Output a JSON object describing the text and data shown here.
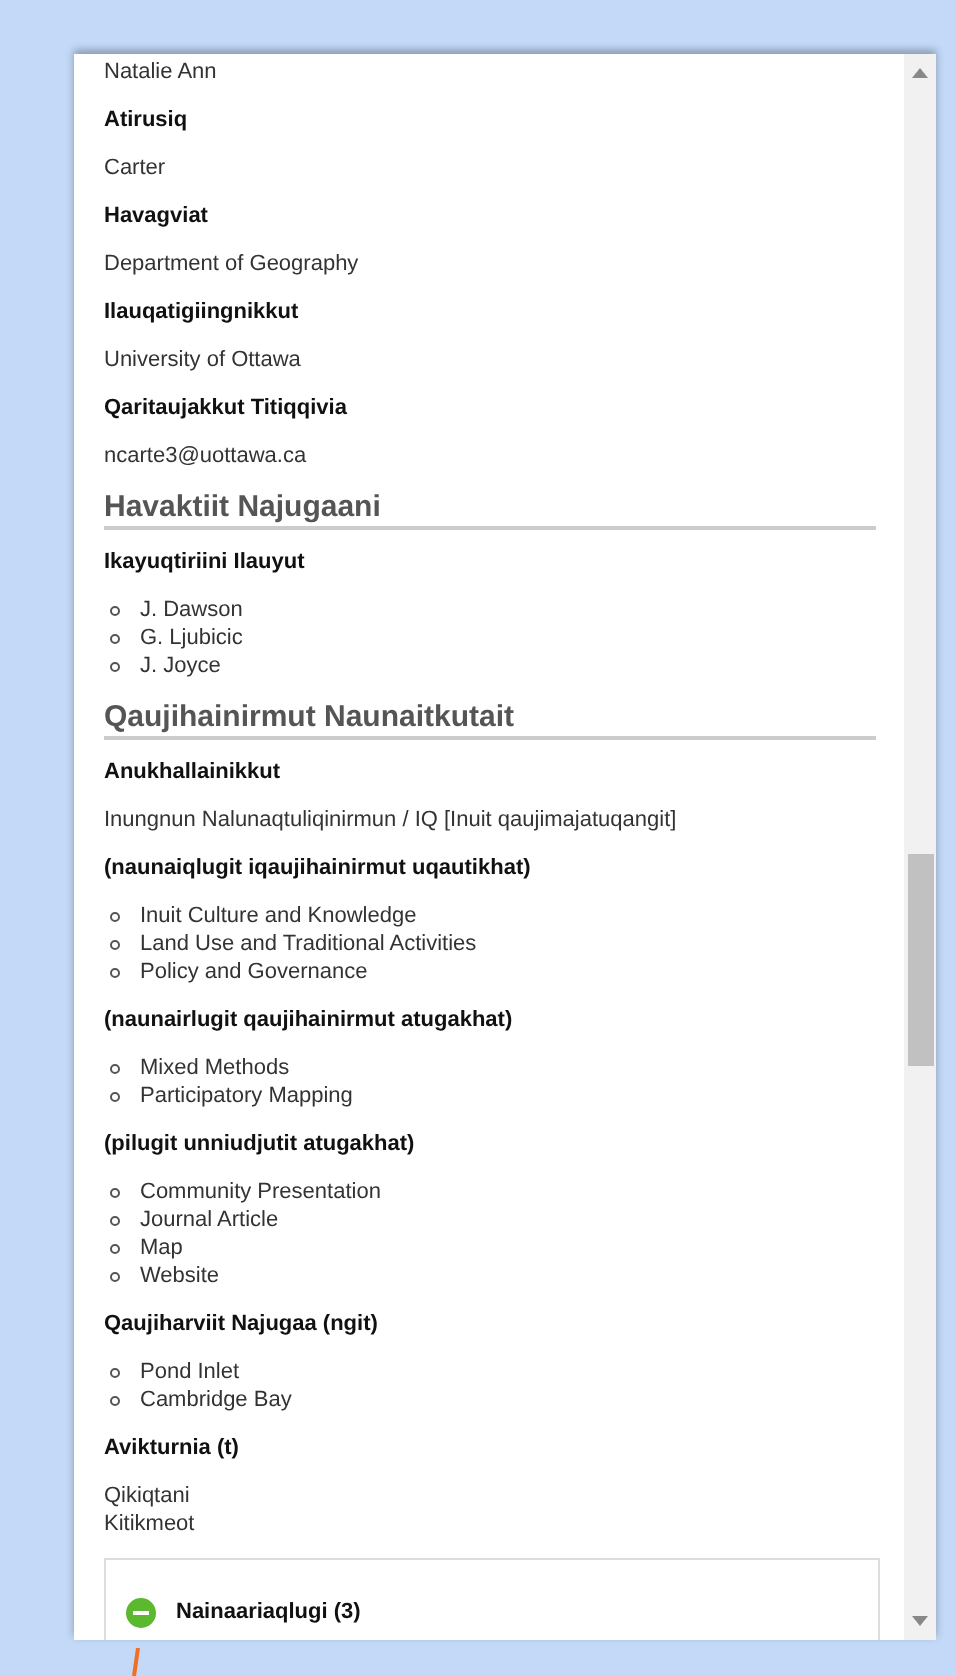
{
  "content": [
    {
      "kind": "value",
      "text": "Natalie Ann"
    },
    {
      "kind": "label",
      "text": "Atirusiq"
    },
    {
      "kind": "value",
      "text": "Carter"
    },
    {
      "kind": "label",
      "text": "Havagviat"
    },
    {
      "kind": "value",
      "text": "Department of Geography"
    },
    {
      "kind": "label",
      "text": "Ilauqatigiingnikkut"
    },
    {
      "kind": "value",
      "text": "University of Ottawa"
    },
    {
      "kind": "label",
      "text": "Qaritaujakkut Titiqqivia"
    },
    {
      "kind": "value",
      "text": "ncarte3@uottawa.ca"
    },
    {
      "kind": "heading",
      "text": "Havaktiit Najugaani"
    },
    {
      "kind": "label",
      "text": "Ikayuqtiriini Ilauyut"
    },
    {
      "kind": "list",
      "items": [
        "J. Dawson",
        "G. Ljubicic",
        "J. Joyce"
      ]
    },
    {
      "kind": "heading",
      "text": "Qaujihainirmut Naunaitkutait"
    },
    {
      "kind": "label",
      "text": "Anukhallainikkut"
    },
    {
      "kind": "value",
      "text": "Inungnun Nalunaqtuliqinirmun / IQ [Inuit qaujimajatuqangit]"
    },
    {
      "kind": "label",
      "text": "(naunaiqlugit iqaujihainirmut uqautikhat)"
    },
    {
      "kind": "list",
      "items": [
        "Inuit Culture and Knowledge",
        "Land Use and Traditional Activities",
        "Policy and Governance"
      ]
    },
    {
      "kind": "label",
      "text": "(naunairlugit qaujihainirmut atugakhat)"
    },
    {
      "kind": "list",
      "items": [
        "Mixed Methods",
        "Participatory Mapping"
      ]
    },
    {
      "kind": "label",
      "text": "(pilugit unniudjutit atugakhat)"
    },
    {
      "kind": "list",
      "items": [
        "Community Presentation",
        "Journal Article",
        "Map",
        "Website"
      ]
    },
    {
      "kind": "label",
      "text": "Qaujiharviit Najugaa (ngit)"
    },
    {
      "kind": "list",
      "items": [
        "Pond Inlet",
        "Cambridge Bay"
      ]
    },
    {
      "kind": "label",
      "text": "Avikturnia (t)"
    },
    {
      "kind": "lines",
      "items": [
        "Qikiqtani",
        "Kitikmeot"
      ]
    }
  ],
  "expander": {
    "label": "Nainaariaqlugi (3)",
    "expanded": true
  }
}
